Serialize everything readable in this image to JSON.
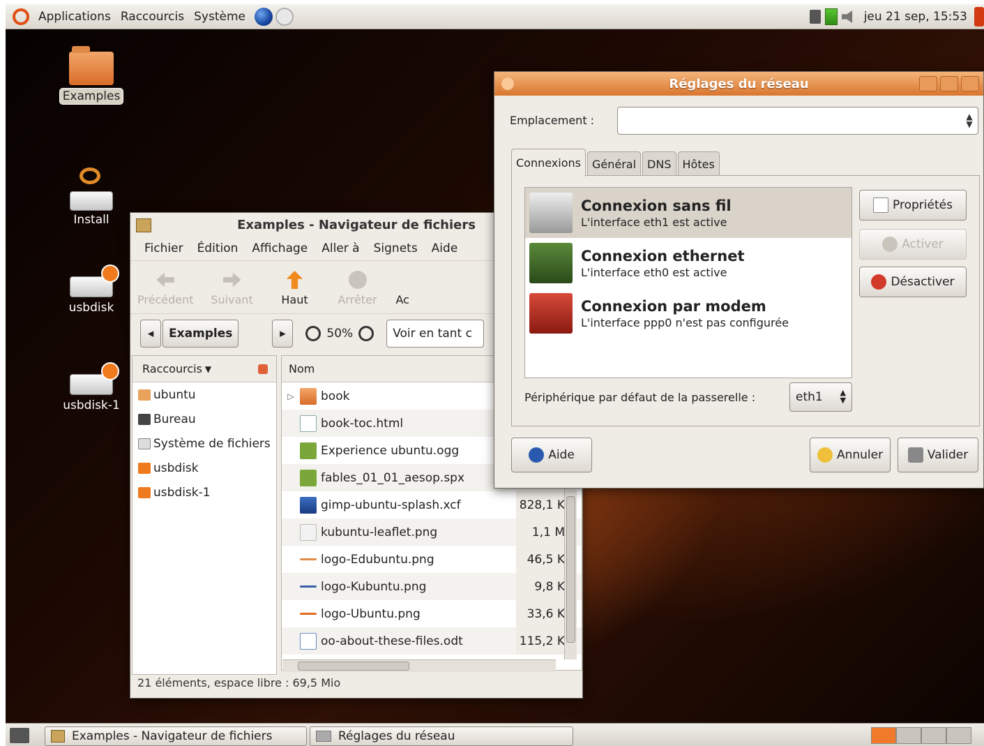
{
  "top_panel": {
    "menus": [
      "Applications",
      "Raccourcis",
      "Système"
    ],
    "clock": "jeu 21 sep, 15:53"
  },
  "desktop_icons": [
    {
      "label": "Examples"
    },
    {
      "label": "Install"
    },
    {
      "label": "usbdisk"
    },
    {
      "label": "usbdisk-1"
    }
  ],
  "file_manager": {
    "title": "Examples - Navigateur de fichiers",
    "menu": [
      "Fichier",
      "Édition",
      "Affichage",
      "Aller à",
      "Signets",
      "Aide"
    ],
    "toolbar": {
      "back": "Précédent",
      "forward": "Suivant",
      "up": "Haut",
      "stop": "Arrêter",
      "cut_label": "Ac"
    },
    "location": {
      "current": "Examples",
      "zoom": "50%",
      "view_as": "Voir en tant c"
    },
    "sidebar": {
      "header": "Raccourcis",
      "items": [
        "ubuntu",
        "Bureau",
        "Système de fichiers",
        "usbdisk",
        "usbdisk-1"
      ]
    },
    "columns": {
      "name": "Nom"
    },
    "files": [
      {
        "name": "book",
        "size": ""
      },
      {
        "name": "book-toc.html",
        "size": ""
      },
      {
        "name": "Experience ubuntu.ogg",
        "size": ""
      },
      {
        "name": "fables_01_01_aesop.spx",
        "size": ""
      },
      {
        "name": "gimp-ubuntu-splash.xcf",
        "size": "828,1 K"
      },
      {
        "name": "kubuntu-leaflet.png",
        "size": "1,1 M"
      },
      {
        "name": "logo-Edubuntu.png",
        "size": "46,5 K"
      },
      {
        "name": "logo-Kubuntu.png",
        "size": "9,8 K"
      },
      {
        "name": "logo-Ubuntu.png",
        "size": "33,6 K"
      },
      {
        "name": "oo-about-these-files.odt",
        "size": "115,2 K"
      }
    ],
    "status": "21 éléments, espace libre : 69,5 Mio"
  },
  "network_dialog": {
    "title": "Réglages du réseau",
    "location_label": "Emplacement :",
    "tabs": [
      "Connexions",
      "Général",
      "DNS",
      "Hôtes"
    ],
    "connections": [
      {
        "title": "Connexion sans fil",
        "subtitle": "L'interface eth1 est active"
      },
      {
        "title": "Connexion ethernet",
        "subtitle": "L'interface eth0 est active"
      },
      {
        "title": "Connexion par modem",
        "subtitle": "L'interface ppp0 n'est pas configurée"
      }
    ],
    "buttons": {
      "properties": "Propriétés",
      "activate": "Activer",
      "deactivate": "Désactiver",
      "help": "Aide",
      "cancel": "Annuler",
      "validate": "Valider"
    },
    "gateway_label": "Périphérique par défaut de la passerelle :",
    "gateway_value": "eth1"
  },
  "taskbar": {
    "tasks": [
      "Examples - Navigateur de fichiers",
      "Réglages du réseau"
    ]
  }
}
